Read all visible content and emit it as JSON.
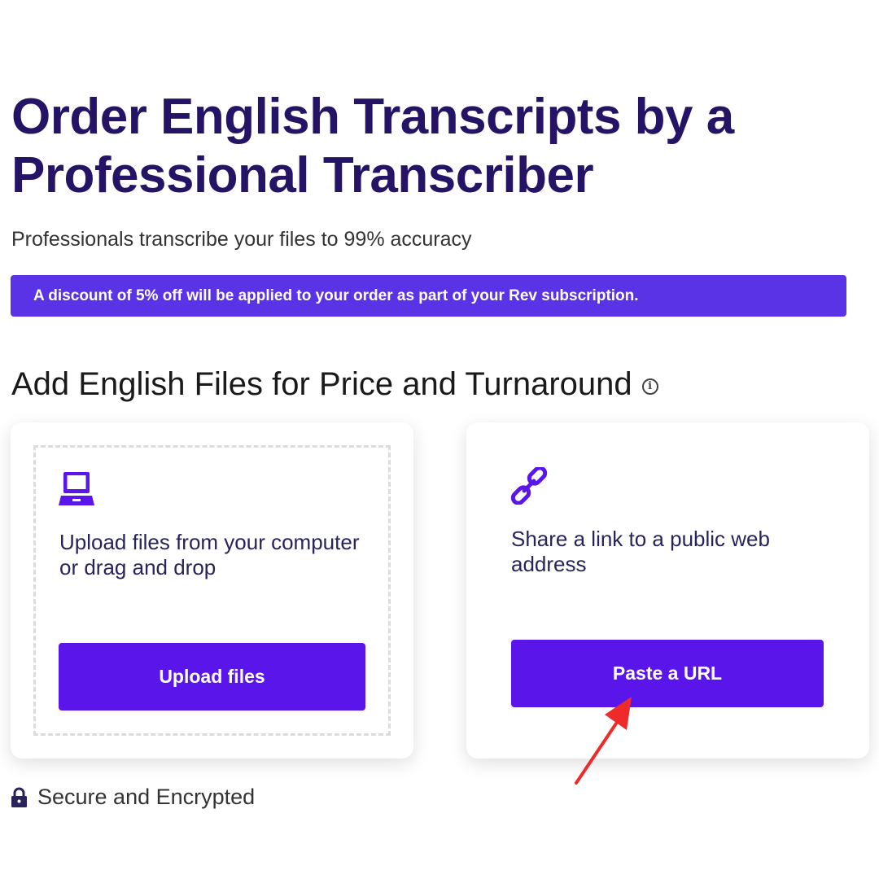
{
  "header": {
    "title_line1": "Order English Transcripts by a",
    "title_line2": "Professional Transcriber",
    "subtitle": "Professionals transcribe your files to 99% accuracy"
  },
  "discount_banner": {
    "text": "A discount of 5% off will be applied to your order as part of your Rev subscription."
  },
  "section": {
    "heading": "Add English Files for Price and Turnaround",
    "info_icon": "info-icon"
  },
  "upload_card": {
    "icon": "laptop-icon",
    "description": "Upload files from your computer or drag and drop",
    "button_label": "Upload files"
  },
  "url_card": {
    "icon": "link-icon",
    "description": "Share a link to a public web address",
    "button_label": "Paste a URL"
  },
  "footer": {
    "icon": "lock-icon",
    "secure_text": "Secure and Encrypted"
  },
  "colors": {
    "title": "#251466",
    "accent": "#5a16ea",
    "banner": "#5b33e6",
    "annotation_arrow": "#ee2a2a"
  }
}
